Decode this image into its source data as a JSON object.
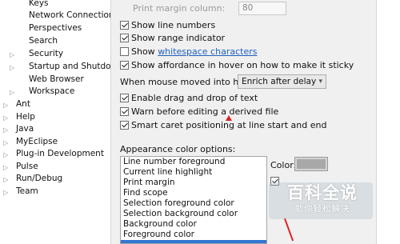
{
  "tree": {
    "items": [
      {
        "label": "Keys",
        "expandable": false
      },
      {
        "label": "Network Connections",
        "expandable": false
      },
      {
        "label": "Perspectives",
        "expandable": false
      },
      {
        "label": "Search",
        "expandable": false
      },
      {
        "label": "Security",
        "expandable": true
      },
      {
        "label": "Startup and Shutdown",
        "expandable": true
      },
      {
        "label": "Web Browser",
        "expandable": false
      },
      {
        "label": "Workspace",
        "expandable": true
      },
      {
        "label": "Ant",
        "expandable": true
      },
      {
        "label": "Help",
        "expandable": true
      },
      {
        "label": "Java",
        "expandable": true
      },
      {
        "label": "MyEclipse",
        "expandable": true
      },
      {
        "label": "Plug-in Development",
        "expandable": true
      },
      {
        "label": "Pulse",
        "expandable": true
      },
      {
        "label": "Run/Debug",
        "expandable": true
      },
      {
        "label": "Team",
        "expandable": true
      }
    ]
  },
  "editor": {
    "print_margin_label": "Print margin column:",
    "print_margin_value": "80",
    "show_line_numbers": {
      "label": "Show line numbers",
      "checked": true
    },
    "show_range_indicator": {
      "label": "Show range indicator",
      "checked": true
    },
    "show_whitespace": {
      "prefix": "Show ",
      "link": "whitespace characters",
      "checked": false
    },
    "show_affordance": {
      "label": "Show affordance in hover on how to make it sticky",
      "checked": true
    },
    "hover_label": "When mouse moved into hover:",
    "hover_select_value": "Enrich after delay",
    "enable_drag_drop": {
      "label": "Enable drag and drop of text",
      "checked": true
    },
    "warn_derived": {
      "label": "Warn before editing a derived file",
      "checked": true
    },
    "smart_caret": {
      "label": "Smart caret positioning at line start and end",
      "checked": true
    },
    "appearance_label": "Appearance color options:",
    "appearance_options": [
      "Line number foreground",
      "Current line highlight",
      "Print margin",
      "Find scope",
      "Selection foreground color",
      "Selection background color",
      "Background color",
      "Foreground color",
      ""
    ],
    "selected_index": 8,
    "color_label": "Color:",
    "swatch_color": "#a8a8a8"
  },
  "watermark": {
    "title": "百科全说",
    "subtitle": "助你轻松解决"
  },
  "colors": {
    "link": "#1f5fbf",
    "selection": "#3276d1",
    "annotation_red": "#e02020"
  }
}
